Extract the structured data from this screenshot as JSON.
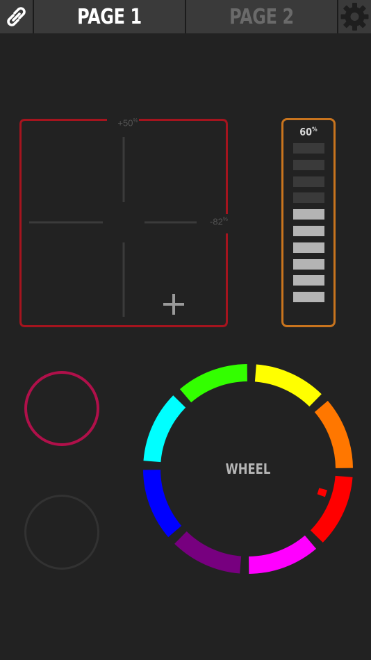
{
  "toolbar": {
    "link_icon": "link-icon",
    "settings_icon": "gear-icon",
    "tabs": [
      {
        "label": "PAGE 1",
        "active": true
      },
      {
        "label": "PAGE 2",
        "active": false
      }
    ]
  },
  "xy_pad": {
    "color": "#a5141e",
    "x_readout": "+50",
    "x_readout_unit": "%",
    "y_readout": "-82",
    "y_readout_unit": "%",
    "cursor_icon": "plus-icon"
  },
  "fader": {
    "color": "#c8741e",
    "value_label": "60",
    "value_unit": "%",
    "level": 0.6,
    "segments": 10
  },
  "push_button": {
    "color": "#b0104a"
  },
  "toggle_button": {
    "color": "#323232"
  },
  "color_wheel": {
    "label": "WHEEL",
    "segment_colors": [
      "#ffff00",
      "#ff7700",
      "#ff0000",
      "#ff00ff",
      "#77007f",
      "#0000ff",
      "#00ffff",
      "#33ff00"
    ],
    "marker_color": "#ff0000"
  }
}
